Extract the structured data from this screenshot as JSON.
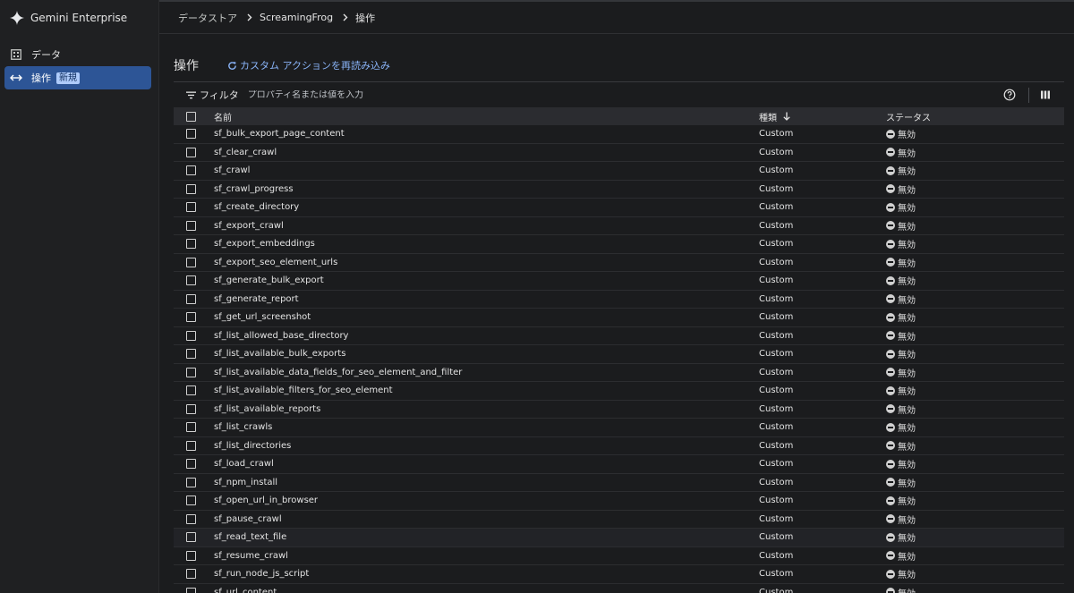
{
  "sidebar": {
    "brand": "Gemini Enterprise",
    "items": [
      {
        "label": "データ",
        "icon": "table-icon"
      },
      {
        "label": "操作",
        "icon": "swap-horiz-icon",
        "badge": "新規",
        "active": true
      }
    ]
  },
  "breadcrumb": [
    "データストア",
    "ScreamingFrog",
    "操作"
  ],
  "page": {
    "title": "操作",
    "reload_label": "カスタム アクションを再読み込み"
  },
  "filter": {
    "label": "フィルタ",
    "placeholder": "プロパティ名または値を入力"
  },
  "table": {
    "headers": {
      "name": "名前",
      "type": "種類",
      "status": "ステータス"
    },
    "rows": [
      {
        "name": "sf_bulk_export_page_content",
        "type": "Custom",
        "status": "無効"
      },
      {
        "name": "sf_clear_crawl",
        "type": "Custom",
        "status": "無効"
      },
      {
        "name": "sf_crawl",
        "type": "Custom",
        "status": "無効"
      },
      {
        "name": "sf_crawl_progress",
        "type": "Custom",
        "status": "無効"
      },
      {
        "name": "sf_create_directory",
        "type": "Custom",
        "status": "無効"
      },
      {
        "name": "sf_export_crawl",
        "type": "Custom",
        "status": "無効"
      },
      {
        "name": "sf_export_embeddings",
        "type": "Custom",
        "status": "無効"
      },
      {
        "name": "sf_export_seo_element_urls",
        "type": "Custom",
        "status": "無効"
      },
      {
        "name": "sf_generate_bulk_export",
        "type": "Custom",
        "status": "無効"
      },
      {
        "name": "sf_generate_report",
        "type": "Custom",
        "status": "無効"
      },
      {
        "name": "sf_get_url_screenshot",
        "type": "Custom",
        "status": "無効"
      },
      {
        "name": "sf_list_allowed_base_directory",
        "type": "Custom",
        "status": "無効"
      },
      {
        "name": "sf_list_available_bulk_exports",
        "type": "Custom",
        "status": "無効"
      },
      {
        "name": "sf_list_available_data_fields_for_seo_element_and_filter",
        "type": "Custom",
        "status": "無効"
      },
      {
        "name": "sf_list_available_filters_for_seo_element",
        "type": "Custom",
        "status": "無効"
      },
      {
        "name": "sf_list_available_reports",
        "type": "Custom",
        "status": "無効"
      },
      {
        "name": "sf_list_crawls",
        "type": "Custom",
        "status": "無効"
      },
      {
        "name": "sf_list_directories",
        "type": "Custom",
        "status": "無効"
      },
      {
        "name": "sf_load_crawl",
        "type": "Custom",
        "status": "無効"
      },
      {
        "name": "sf_npm_install",
        "type": "Custom",
        "status": "無効"
      },
      {
        "name": "sf_open_url_in_browser",
        "type": "Custom",
        "status": "無効"
      },
      {
        "name": "sf_pause_crawl",
        "type": "Custom",
        "status": "無効"
      },
      {
        "name": "sf_read_text_file",
        "type": "Custom",
        "status": "無効"
      },
      {
        "name": "sf_resume_crawl",
        "type": "Custom",
        "status": "無効"
      },
      {
        "name": "sf_run_node_js_script",
        "type": "Custom",
        "status": "無効"
      },
      {
        "name": "sf_url_content",
        "type": "Custom",
        "status": "無効"
      }
    ]
  },
  "colors": {
    "accent": "#8ab4f8",
    "active_nav": "#2d5596",
    "background": "#1b1c1e"
  }
}
